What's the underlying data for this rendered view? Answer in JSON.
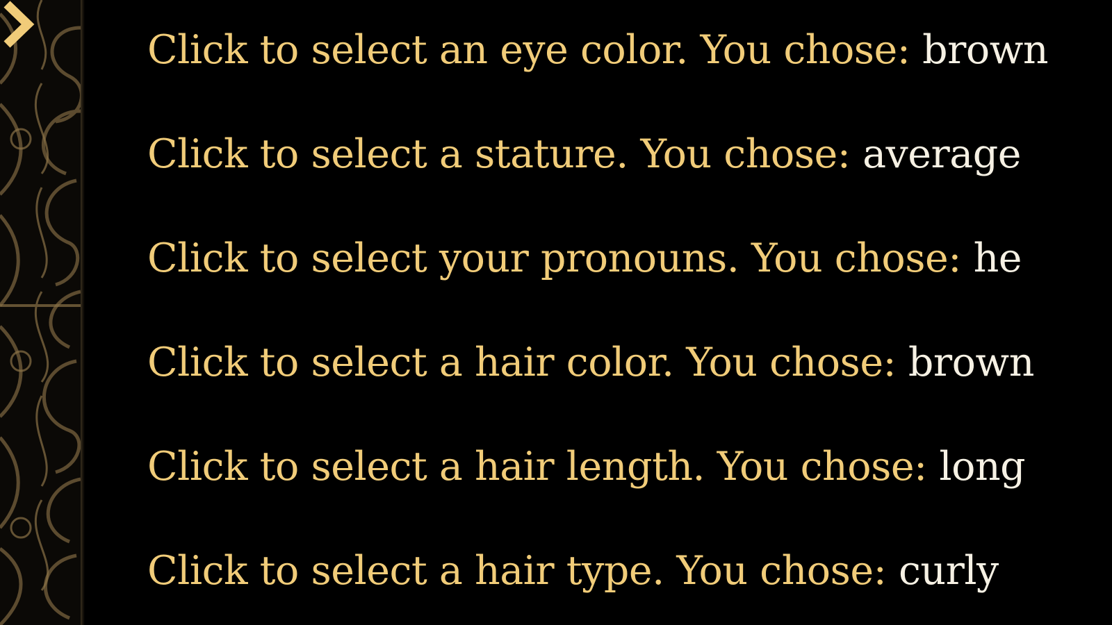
{
  "theme": {
    "prompt_color": "#f1cc79",
    "value_color": "#f6f1e4",
    "background": "#000000",
    "ornament_color": "#6b5737"
  },
  "nav": {
    "current_icon": "chevron-right-icon"
  },
  "choices": [
    {
      "prompt": "Click to select an eye color. You chose:",
      "value": "brown"
    },
    {
      "prompt": "Click to select a stature. You chose:",
      "value": "average"
    },
    {
      "prompt": "Click to select your pronouns. You chose:",
      "value": "he"
    },
    {
      "prompt": "Click to select a hair color. You chose:",
      "value": "brown"
    },
    {
      "prompt": "Click to select a hair length. You chose:",
      "value": "long"
    },
    {
      "prompt": "Click to select a hair type. You chose:",
      "value": "curly"
    }
  ]
}
